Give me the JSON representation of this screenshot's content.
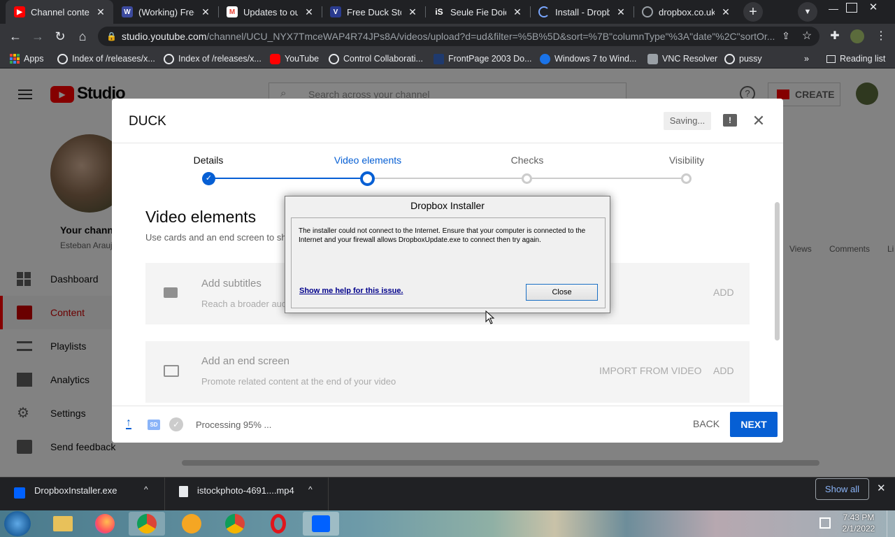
{
  "browser": {
    "tabs": [
      {
        "title": "Channel content",
        "favicon": "youtube-icon",
        "color": "#ff0000",
        "active": true
      },
      {
        "title": "(Working) Free",
        "favicon": "working-icon",
        "color": "#3c4a9e"
      },
      {
        "title": "Updates to our",
        "favicon": "gmail-icon",
        "color": "#ea4335"
      },
      {
        "title": "Free Duck Stock",
        "favicon": "v-icon",
        "color": "#2a3b8f"
      },
      {
        "title": "Seule Fie Doies",
        "favicon": "is-icon",
        "color": "#222222"
      },
      {
        "title": "Install - Dropbo",
        "favicon": "loading-icon",
        "color": "#7aa7ff"
      },
      {
        "title": "dropbox.co.uk",
        "favicon": "globe-icon",
        "color": "#9aa0a6"
      }
    ],
    "url_host": "studio.youtube.com",
    "url_path": "/channel/UCU_NYX7TmceWAP4R74JPs8A/videos/upload?d=ud&filter=%5B%5D&sort=%7B\"columnType\"%3A\"date\"%2C\"sortOr...",
    "bookmarks": [
      {
        "label": "Apps",
        "icon": "apps-grid-icon"
      },
      {
        "label": "Index of /releases/x...",
        "icon": "globe-icon"
      },
      {
        "label": "Index of /releases/x...",
        "icon": "globe-icon"
      },
      {
        "label": "YouTube",
        "icon": "youtube-icon"
      },
      {
        "label": "Control Collaborati...",
        "icon": "globe-icon"
      },
      {
        "label": "FrontPage 2003 Do...",
        "icon": "page-icon"
      },
      {
        "label": "Windows 7 to Wind...",
        "icon": "windows-icon"
      },
      {
        "label": "VNC Resolver",
        "icon": "vnc-icon"
      },
      {
        "label": "pussy",
        "icon": "globe-icon"
      }
    ],
    "reading_list": "Reading list",
    "more": "»"
  },
  "studio": {
    "logo_text": "Studio",
    "search_placeholder": "Search across your channel",
    "create_label": "CREATE",
    "channel_label": "Your channel",
    "channel_name": "Esteban Araujo",
    "sidebar": [
      {
        "label": "Dashboard",
        "icon": "dashboard-icon"
      },
      {
        "label": "Content",
        "icon": "content-icon",
        "active": true
      },
      {
        "label": "Playlists",
        "icon": "playlists-icon"
      },
      {
        "label": "Analytics",
        "icon": "analytics-icon"
      },
      {
        "label": "Settings",
        "icon": "settings-icon"
      },
      {
        "label": "Send feedback",
        "icon": "feedback-icon"
      }
    ],
    "bg_columns": [
      "Views",
      "Comments",
      "Li"
    ]
  },
  "modal": {
    "title": "DUCK",
    "saving": "Saving...",
    "steps": [
      "Details",
      "Video elements",
      "Checks",
      "Visibility"
    ],
    "current_step": 1,
    "section_title": "Video elements",
    "section_desc": "Use cards and an end screen to show viewers related videos, websites, and calls to action. Learn more",
    "cards": [
      {
        "title": "Add subtitles",
        "desc": "Reach a broader audience by adding subtitles to your video",
        "actions": [
          "ADD"
        ],
        "icon": "subtitles-icon"
      },
      {
        "title": "Add an end screen",
        "desc": "Promote related content at the end of your video",
        "actions": [
          "IMPORT FROM VIDEO",
          "ADD"
        ],
        "icon": "end-screen-icon"
      }
    ],
    "footer": {
      "status": "Processing 95% ...",
      "processing_progress": 95,
      "back": "BACK",
      "next": "NEXT",
      "sd_badge": "SD"
    }
  },
  "dialog": {
    "title": "Dropbox Installer",
    "message": "The installer could not connect to the Internet. Ensure that your computer is connected to the Internet and your firewall allows DropboxUpdate.exe to connect then try again.",
    "help_link": "Show me help for this issue.",
    "close_label": "Close"
  },
  "downloads": {
    "items": [
      {
        "name": "DropboxInstaller.exe",
        "icon": "dropbox-icon"
      },
      {
        "name": "istockphoto-4691....mp4",
        "icon": "file-icon"
      }
    ],
    "show_all": "Show all"
  },
  "taskbar": {
    "time": "7:43 PM",
    "date": "2/1/2022",
    "apps": [
      "file-explorer-icon",
      "firefox-icon",
      "chrome-icon",
      "brave-icon",
      "brave-icon",
      "opera-icon",
      "dropbox-icon"
    ]
  },
  "colors": {
    "accent": "#065fd4",
    "youtube_red": "#ff0000",
    "tab_bg": "#202124",
    "toolbar": "#35363a"
  }
}
